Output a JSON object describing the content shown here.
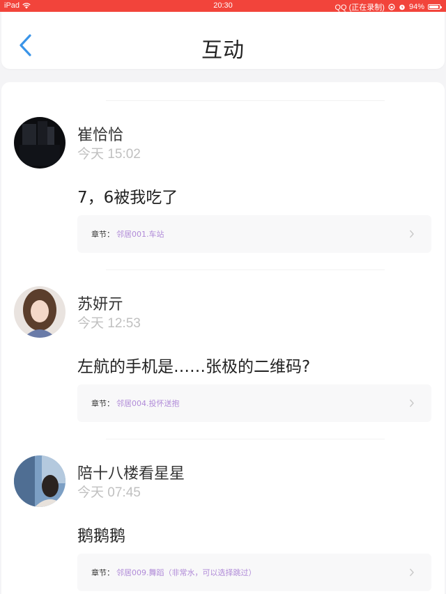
{
  "status_bar": {
    "device": "iPad",
    "time": "20:30",
    "app_status": "QQ (正在录制)",
    "battery": "94%",
    "battery_level": 0.94
  },
  "header": {
    "title": "互动"
  },
  "colors": {
    "status_bar": "#f2443b",
    "accent": "#3a94e8",
    "chapter_link": "#b08ad8"
  },
  "posts": [
    {
      "username": "崔恰恰",
      "time": "今天 15:02",
      "content": "7，6被我吃了",
      "chapter_label": "章节：",
      "chapter_value": "邻居001.车站"
    },
    {
      "username": "苏妍亓",
      "time": "今天 12:53",
      "content": "左航的手机是……张极的二维码?",
      "chapter_label": "章节：",
      "chapter_value": "邻居004.投怀送抱"
    },
    {
      "username": "陪十八楼看星星",
      "time": "今天 07:45",
      "content": "鹅鹅鹅",
      "chapter_label": "章节：",
      "chapter_value": "邻居009.舞蹈（非常水，可以选择跳过）"
    }
  ]
}
